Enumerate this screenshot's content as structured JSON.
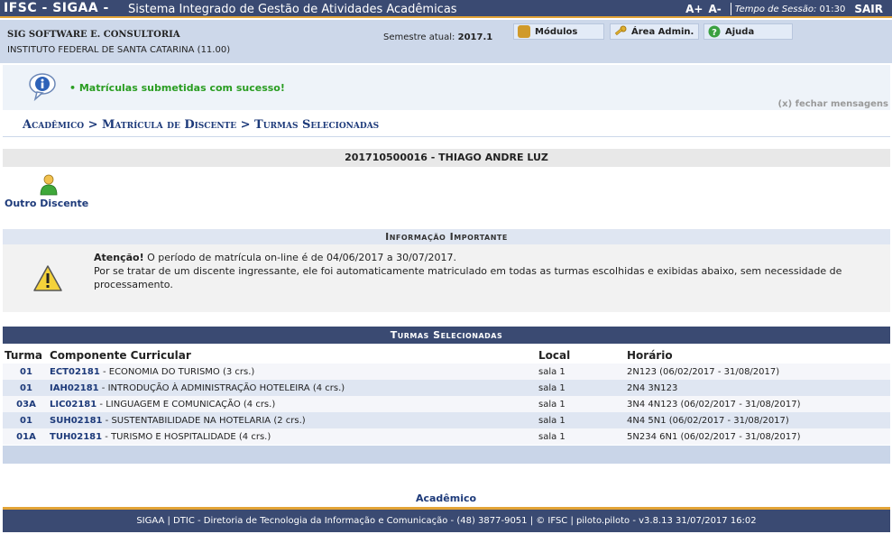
{
  "topbar": {
    "brand": "IFSC - SIGAA -",
    "subtitle": "Sistema Integrado de Gestão de Atividades Acadêmicas",
    "font_increase": "A+",
    "font_decrease": "A-",
    "session_label": "Tempo de Sessão:",
    "session_time": "01:30",
    "exit": "SAIR"
  },
  "infobar": {
    "org": "SIG SOFTWARE E. CONSULTORIA",
    "institution": "INSTITUTO FEDERAL DE SANTA CATARINA (11.00)",
    "semester_label": "Semestre atual:",
    "semester_value": "2017.1",
    "menus": [
      {
        "label": "Módulos",
        "icon": "modules-icon",
        "color": "#d09a2a"
      },
      {
        "label": "Área Admin.",
        "icon": "key-icon",
        "color": "#e0b030"
      },
      {
        "label": "Ajuda",
        "icon": "help-icon",
        "color": "#3aa040"
      }
    ]
  },
  "message": {
    "text": "• Matrículas submetidas com sucesso!",
    "close": "(x) fechar mensagens"
  },
  "breadcrumb": "Acadêmico > Matrícula de Discente > Turmas Selecionadas",
  "student": "201710500016 - THIAGO ANDRE LUZ",
  "outro_discente": "Outro Discente",
  "important": {
    "title": "Informação Importante",
    "attention_label": "Atenção!",
    "attention_text": " O período de matrícula on-line é de 04/06/2017 a 30/07/2017.",
    "note": "Por se tratar de um discente ingressante, ele foi automaticamente matriculado em todas as turmas escolhidas e exibidas abaixo, sem necessidade de processamento."
  },
  "turmas": {
    "title": "Turmas Selecionadas",
    "columns": [
      "Turma",
      "Componente Curricular",
      "Local",
      "Horário"
    ],
    "rows": [
      {
        "turma": "01",
        "code": "ECT02181",
        "name": " - ECONOMIA DO TURISMO (3 crs.)",
        "local": "sala 1",
        "horario": "2N123 (06/02/2017 - 31/08/2017)"
      },
      {
        "turma": "01",
        "code": "IAH02181",
        "name": " - INTRODUÇÃO À ADMINISTRAÇÃO HOTELEIRA (4 crs.)",
        "local": "sala 1",
        "horario": "2N4 3N123"
      },
      {
        "turma": "03A",
        "code": "LIC02181",
        "name": " - LINGUAGEM E COMUNICAÇÃO (4 crs.)",
        "local": "sala 1",
        "horario": "3N4 4N123 (06/02/2017 - 31/08/2017)"
      },
      {
        "turma": "01",
        "code": "SUH02181",
        "name": " - SUSTENTABILIDADE NA HOTELARIA (2 crs.)",
        "local": "sala 1",
        "horario": "4N4 5N1 (06/02/2017 - 31/08/2017)"
      },
      {
        "turma": "01A",
        "code": "TUH02181",
        "name": " - TURISMO E HOSPITALIDADE (4 crs.)",
        "local": "sala 1",
        "horario": "5N234 6N1 (06/02/2017 - 31/08/2017)"
      }
    ]
  },
  "academico_link": "Acadêmico",
  "footer": "SIGAA | DTIC - Diretoria de Tecnologia da Informação e Comunicação - (48) 3877-9051 | © IFSC | piloto.piloto - v3.8.13 31/07/2017 16:02"
}
